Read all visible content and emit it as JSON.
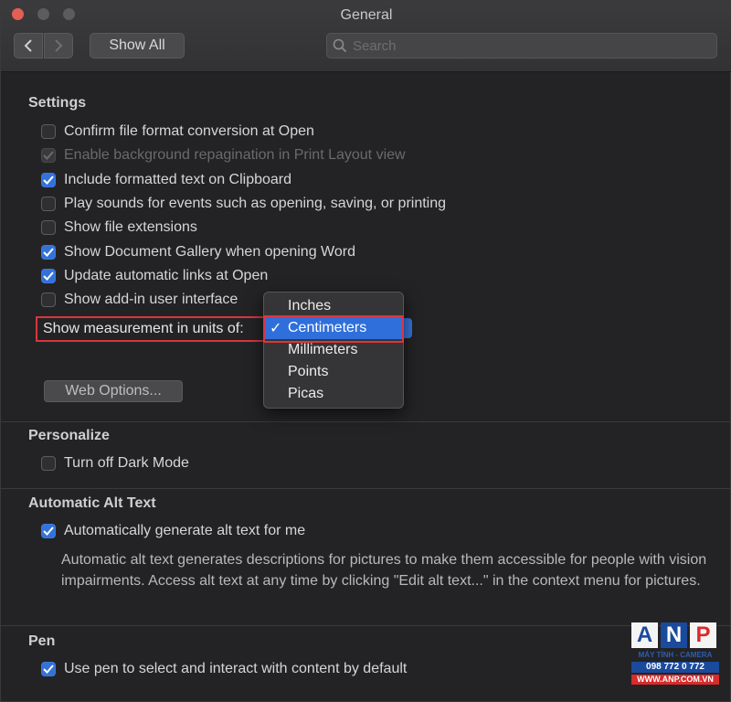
{
  "window": {
    "title": "General"
  },
  "toolbar": {
    "show_all_label": "Show All",
    "search_placeholder": "Search"
  },
  "settings": {
    "title": "Settings",
    "items": [
      {
        "label": "Confirm file format conversion at Open",
        "checked": false,
        "enabled": true
      },
      {
        "label": "Enable background repagination in Print Layout view",
        "checked": true,
        "enabled": false
      },
      {
        "label": "Include formatted text on Clipboard",
        "checked": true,
        "enabled": true
      },
      {
        "label": "Play sounds for events such as opening, saving, or printing",
        "checked": false,
        "enabled": true
      },
      {
        "label": "Show file extensions",
        "checked": false,
        "enabled": true
      },
      {
        "label": "Show Document Gallery when opening Word",
        "checked": true,
        "enabled": true
      },
      {
        "label": "Update automatic links at Open",
        "checked": true,
        "enabled": true
      },
      {
        "label": "Show add-in user interface",
        "checked": false,
        "enabled": true
      }
    ],
    "measurement_label": "Show measurement in units of:",
    "web_options_label": "Web Options..."
  },
  "measurement_menu": {
    "options": [
      "Inches",
      "Centimeters",
      "Millimeters",
      "Points",
      "Picas"
    ],
    "selected": "Centimeters"
  },
  "personalize": {
    "title": "Personalize",
    "dark_mode_label": "Turn off Dark Mode",
    "dark_mode_checked": false
  },
  "alt_text": {
    "title": "Automatic Alt Text",
    "auto_label": "Automatically generate alt text for me",
    "auto_checked": true,
    "description": "Automatic alt text generates descriptions for pictures to make them accessible for people with vision impairments. Access alt text at any time by clicking \"Edit alt text...\" in the context menu for pictures."
  },
  "pen": {
    "title": "Pen",
    "use_pen_label": "Use pen to select and interact with content by default",
    "use_pen_checked": true
  },
  "watermark": {
    "letters": [
      "A",
      "N",
      "P"
    ],
    "line1": "MÁY TÍNH - CAMERA",
    "line2": "098 772 0 772",
    "line3": "WWW.ANP.COM.VN"
  },
  "colors": {
    "accent": "#2f6fdc",
    "highlight_box": "#d9363e",
    "background": "#232325"
  }
}
